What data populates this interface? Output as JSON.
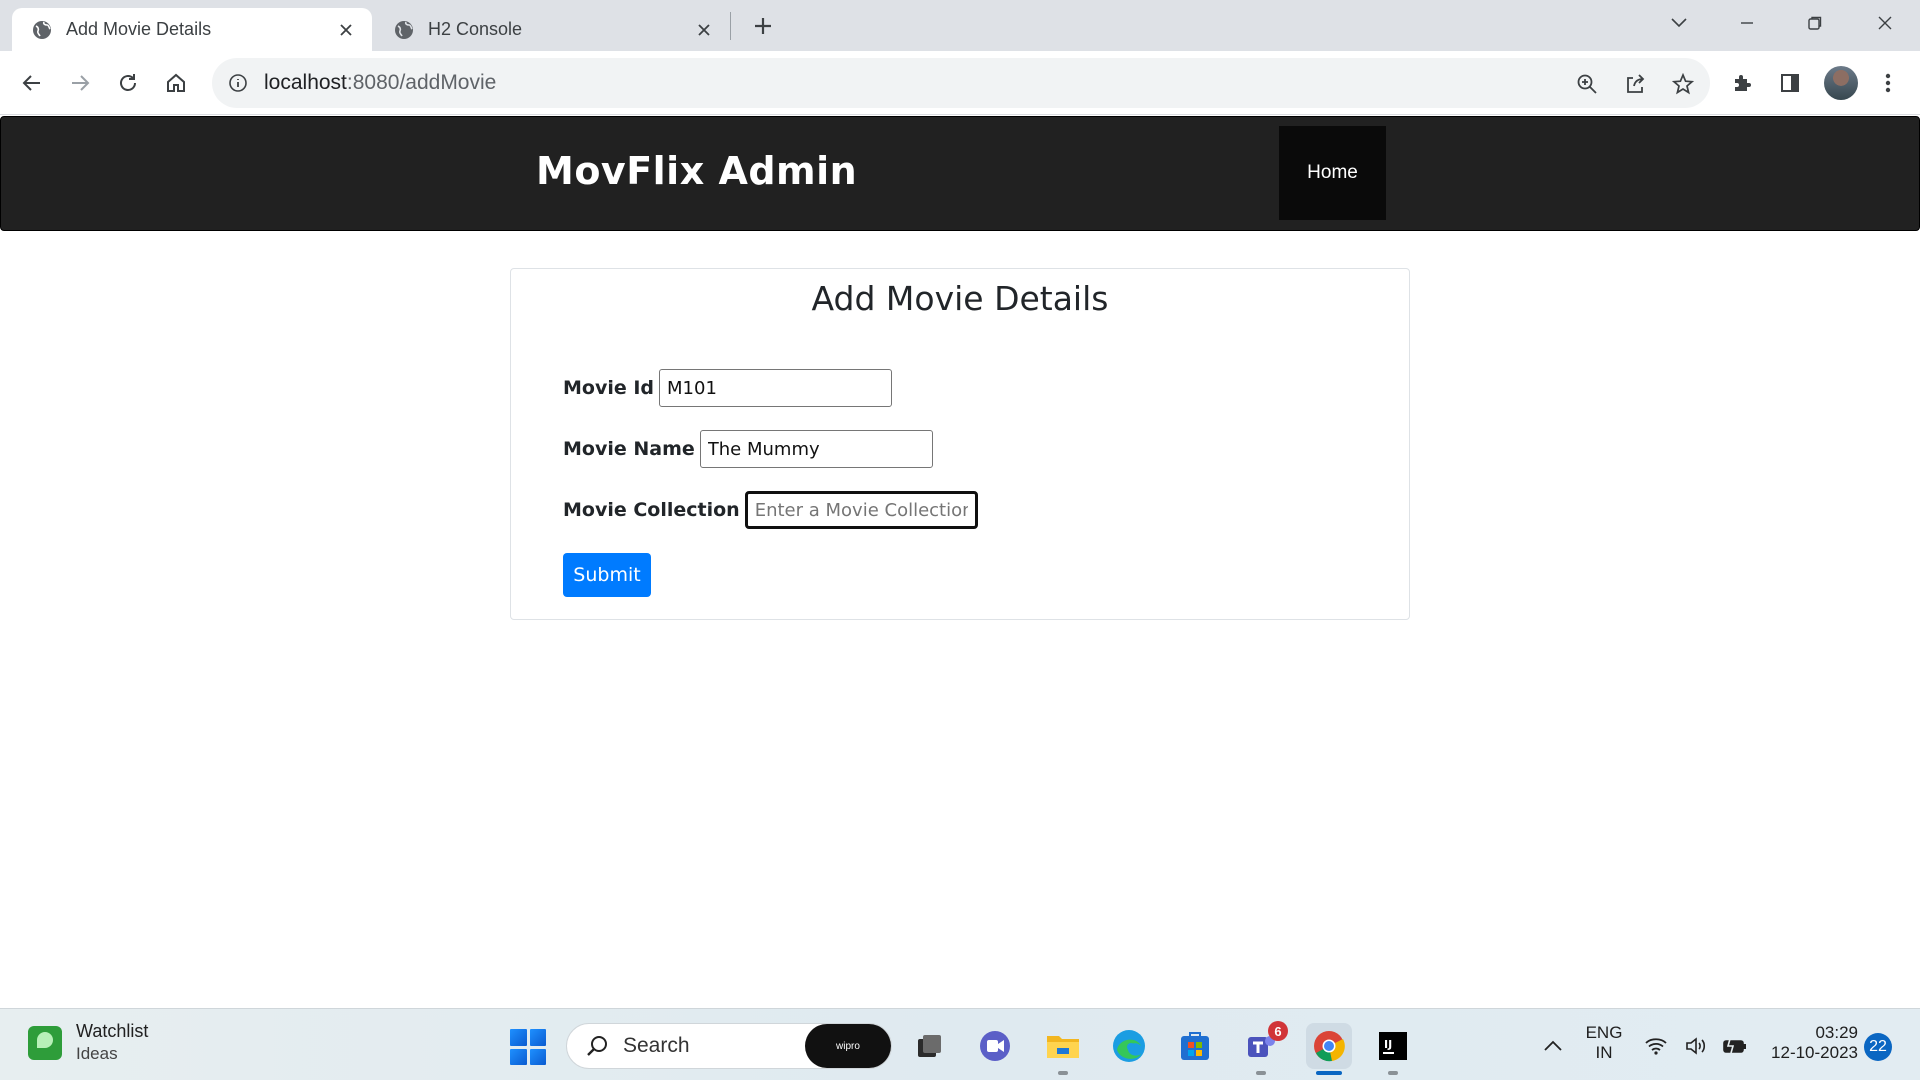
{
  "browser": {
    "tabs": [
      {
        "title": "Add Movie Details",
        "active": true
      },
      {
        "title": "H2 Console",
        "active": false
      }
    ],
    "url_host": "localhost",
    "url_path": ":8080/addMovie"
  },
  "page": {
    "brand": "MovFlix Admin",
    "nav_home": "Home",
    "form_title": "Add Movie Details",
    "fields": {
      "movie_id": {
        "label": "Movie Id",
        "value": "M101"
      },
      "movie_name": {
        "label": "Movie Name",
        "value": "The Mummy"
      },
      "movie_collection": {
        "label": "Movie Collection",
        "value": "",
        "placeholder": "Enter a Movie Collection"
      }
    },
    "submit_label": "Submit"
  },
  "taskbar": {
    "weather_title": "Watchlist",
    "weather_sub": "Ideas",
    "search_label": "Search",
    "wipro_label": "wipro",
    "teams_badge": "6",
    "lang_top": "ENG",
    "lang_bottom": "IN",
    "time": "03:29",
    "date": "12-10-2023",
    "notifications": "22"
  },
  "colors": {
    "navbar": "#212121",
    "submit": "#007bff"
  }
}
